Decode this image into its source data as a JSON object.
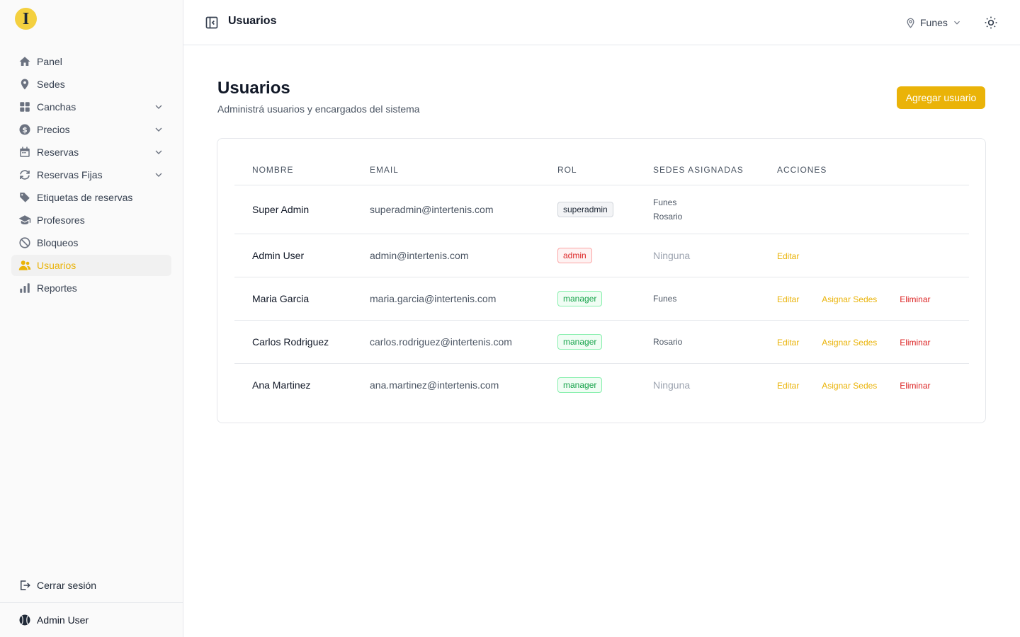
{
  "sidebar": {
    "logo_letter": "I",
    "items": [
      {
        "label": "Panel",
        "icon": "home-icon",
        "expandable": false
      },
      {
        "label": "Sedes",
        "icon": "map-pin-icon",
        "expandable": false
      },
      {
        "label": "Canchas",
        "icon": "grid-icon",
        "expandable": true
      },
      {
        "label": "Precios",
        "icon": "dollar-icon",
        "expandable": true
      },
      {
        "label": "Reservas",
        "icon": "calendar-icon",
        "expandable": true
      },
      {
        "label": "Reservas Fijas",
        "icon": "refresh-icon",
        "expandable": true
      },
      {
        "label": "Etiquetas de reservas",
        "icon": "tag-icon",
        "expandable": false
      },
      {
        "label": "Profesores",
        "icon": "graduation-cap-icon",
        "expandable": false
      },
      {
        "label": "Bloqueos",
        "icon": "ban-icon",
        "expandable": false
      },
      {
        "label": "Usuarios",
        "icon": "users-icon",
        "expandable": false,
        "active": true
      },
      {
        "label": "Reportes",
        "icon": "bar-chart-icon",
        "expandable": false
      }
    ],
    "logout_label": "Cerrar sesión",
    "user_name": "Admin User"
  },
  "header": {
    "title": "Usuarios",
    "location": "Funes"
  },
  "main": {
    "title": "Usuarios",
    "subtitle": "Administrá usuarios y encargados del sistema",
    "add_button": "Agregar usuario"
  },
  "table": {
    "columns": [
      "NOMBRE",
      "EMAIL",
      "ROL",
      "SEDES ASIGNADAS",
      "ACCIONES"
    ],
    "rows": [
      {
        "name": "Super Admin",
        "email": "superadmin@intertenis.com",
        "role": "superadmin",
        "sedes": [
          "Funes",
          "Rosario"
        ],
        "actions": []
      },
      {
        "name": "Admin User",
        "email": "admin@intertenis.com",
        "role": "admin",
        "sedes": [],
        "sedes_empty": "Ninguna",
        "actions": [
          "Editar"
        ]
      },
      {
        "name": "Maria Garcia",
        "email": "maria.garcia@intertenis.com",
        "role": "manager",
        "sedes": [
          "Funes"
        ],
        "actions": [
          "Editar",
          "Asignar Sedes",
          "Eliminar"
        ]
      },
      {
        "name": "Carlos Rodriguez",
        "email": "carlos.rodriguez@intertenis.com",
        "role": "manager",
        "sedes": [
          "Rosario"
        ],
        "actions": [
          "Editar",
          "Asignar Sedes",
          "Eliminar"
        ]
      },
      {
        "name": "Ana Martinez",
        "email": "ana.martinez@intertenis.com",
        "role": "manager",
        "sedes": [],
        "sedes_empty": "Ninguna",
        "actions": [
          "Editar",
          "Asignar Sedes",
          "Eliminar"
        ]
      }
    ]
  },
  "colors": {
    "accent": "#eab308",
    "danger": "#dc2626",
    "success": "#16a34a"
  }
}
